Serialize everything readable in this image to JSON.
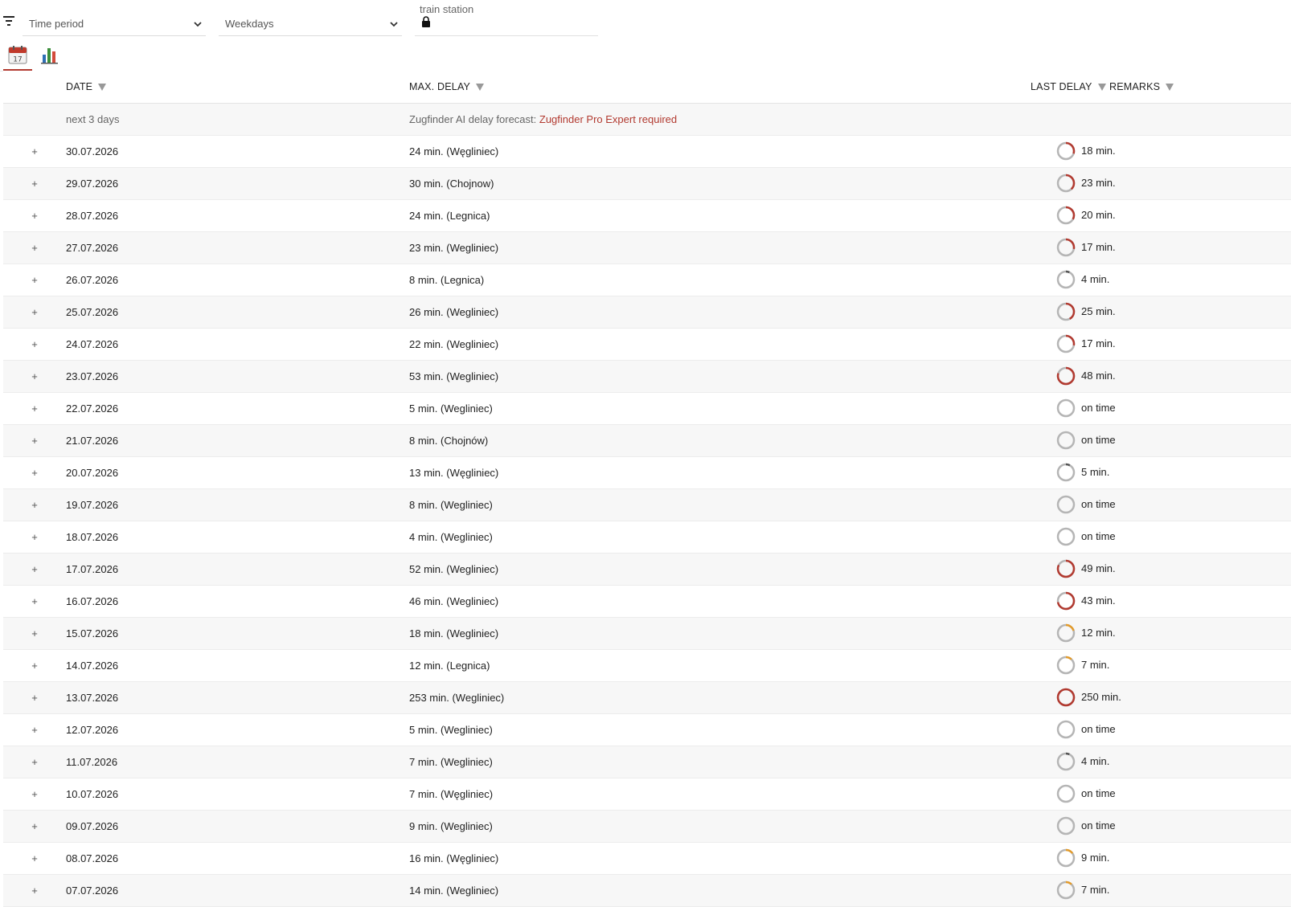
{
  "filters": {
    "time_period": "Time period",
    "weekdays": "Weekdays",
    "station_label": "train station"
  },
  "colors": {
    "accent": "#b23a30",
    "ring_track": "#b5b5b5",
    "ring_orange": "#e39b2b"
  },
  "tabs": [
    {
      "icon": "calendar-icon",
      "calendar_day": "17",
      "active": true
    },
    {
      "icon": "bar-chart-icon",
      "active": false
    }
  ],
  "table": {
    "columns": {
      "date": "DATE",
      "max_delay": "MAX. DELAY",
      "last_delay": "LAST DELAY",
      "remarks": "REMARKS"
    },
    "forecast": {
      "date": "next 3 days",
      "text": "Zugfinder AI delay forecast: ",
      "link": "Zugfinder Pro Expert required"
    },
    "expand_symbol": "+",
    "rows": [
      {
        "date": "30.07.2026",
        "max_delay": "24 min. (Węgliniec)",
        "last_delay": "18 min.",
        "ring": 0.3,
        "ring_color": "#b23a30"
      },
      {
        "date": "29.07.2026",
        "max_delay": "30 min. (Chojnow)",
        "last_delay": "23 min.",
        "ring": 0.38,
        "ring_color": "#b23a30"
      },
      {
        "date": "28.07.2026",
        "max_delay": "24 min. (Legnica)",
        "last_delay": "20 min.",
        "ring": 0.33,
        "ring_color": "#b23a30"
      },
      {
        "date": "27.07.2026",
        "max_delay": "23 min. (Wegliniec)",
        "last_delay": "17 min.",
        "ring": 0.28,
        "ring_color": "#b23a30"
      },
      {
        "date": "26.07.2026",
        "max_delay": "8 min. (Legnica)",
        "last_delay": "4 min.",
        "ring": 0.07,
        "ring_color": "#555555"
      },
      {
        "date": "25.07.2026",
        "max_delay": "26 min. (Wegliniec)",
        "last_delay": "25 min.",
        "ring": 0.42,
        "ring_color": "#b23a30"
      },
      {
        "date": "24.07.2026",
        "max_delay": "22 min. (Wegliniec)",
        "last_delay": "17 min.",
        "ring": 0.28,
        "ring_color": "#b23a30"
      },
      {
        "date": "23.07.2026",
        "max_delay": "53 min. (Wegliniec)",
        "last_delay": "48 min.",
        "ring": 0.8,
        "ring_color": "#b23a30"
      },
      {
        "date": "22.07.2026",
        "max_delay": "5 min. (Wegliniec)",
        "last_delay": "on time",
        "ring": 0,
        "ring_color": "#b5b5b5"
      },
      {
        "date": "21.07.2026",
        "max_delay": "8 min. (Chojnów)",
        "last_delay": "on time",
        "ring": 0,
        "ring_color": "#b5b5b5"
      },
      {
        "date": "20.07.2026",
        "max_delay": "13 min. (Węgliniec)",
        "last_delay": "5 min.",
        "ring": 0.08,
        "ring_color": "#555555"
      },
      {
        "date": "19.07.2026",
        "max_delay": "8 min. (Wegliniec)",
        "last_delay": "on time",
        "ring": 0,
        "ring_color": "#b5b5b5"
      },
      {
        "date": "18.07.2026",
        "max_delay": "4 min. (Wegliniec)",
        "last_delay": "on time",
        "ring": 0,
        "ring_color": "#b5b5b5"
      },
      {
        "date": "17.07.2026",
        "max_delay": "52 min. (Wegliniec)",
        "last_delay": "49 min.",
        "ring": 0.82,
        "ring_color": "#b23a30"
      },
      {
        "date": "16.07.2026",
        "max_delay": "46 min. (Wegliniec)",
        "last_delay": "43 min.",
        "ring": 0.72,
        "ring_color": "#b23a30"
      },
      {
        "date": "15.07.2026",
        "max_delay": "18 min. (Wegliniec)",
        "last_delay": "12 min.",
        "ring": 0.2,
        "ring_color": "#e39b2b"
      },
      {
        "date": "14.07.2026",
        "max_delay": "12 min. (Legnica)",
        "last_delay": "7 min.",
        "ring": 0.12,
        "ring_color": "#e39b2b"
      },
      {
        "date": "13.07.2026",
        "max_delay": "253 min. (Wegliniec)",
        "last_delay": "250 min.",
        "ring": 1,
        "ring_color": "#b23a30"
      },
      {
        "date": "12.07.2026",
        "max_delay": "5 min. (Wegliniec)",
        "last_delay": "on time",
        "ring": 0,
        "ring_color": "#b5b5b5"
      },
      {
        "date": "11.07.2026",
        "max_delay": "7 min. (Wegliniec)",
        "last_delay": "4 min.",
        "ring": 0.07,
        "ring_color": "#555555"
      },
      {
        "date": "10.07.2026",
        "max_delay": "7 min. (Węgliniec)",
        "last_delay": "on time",
        "ring": 0,
        "ring_color": "#b5b5b5"
      },
      {
        "date": "09.07.2026",
        "max_delay": "9 min. (Wegliniec)",
        "last_delay": "on time",
        "ring": 0,
        "ring_color": "#b5b5b5"
      },
      {
        "date": "08.07.2026",
        "max_delay": "16 min. (Węgliniec)",
        "last_delay": "9 min.",
        "ring": 0.15,
        "ring_color": "#e39b2b"
      },
      {
        "date": "07.07.2026",
        "max_delay": "14 min. (Wegliniec)",
        "last_delay": "7 min.",
        "ring": 0.12,
        "ring_color": "#e39b2b"
      }
    ]
  }
}
